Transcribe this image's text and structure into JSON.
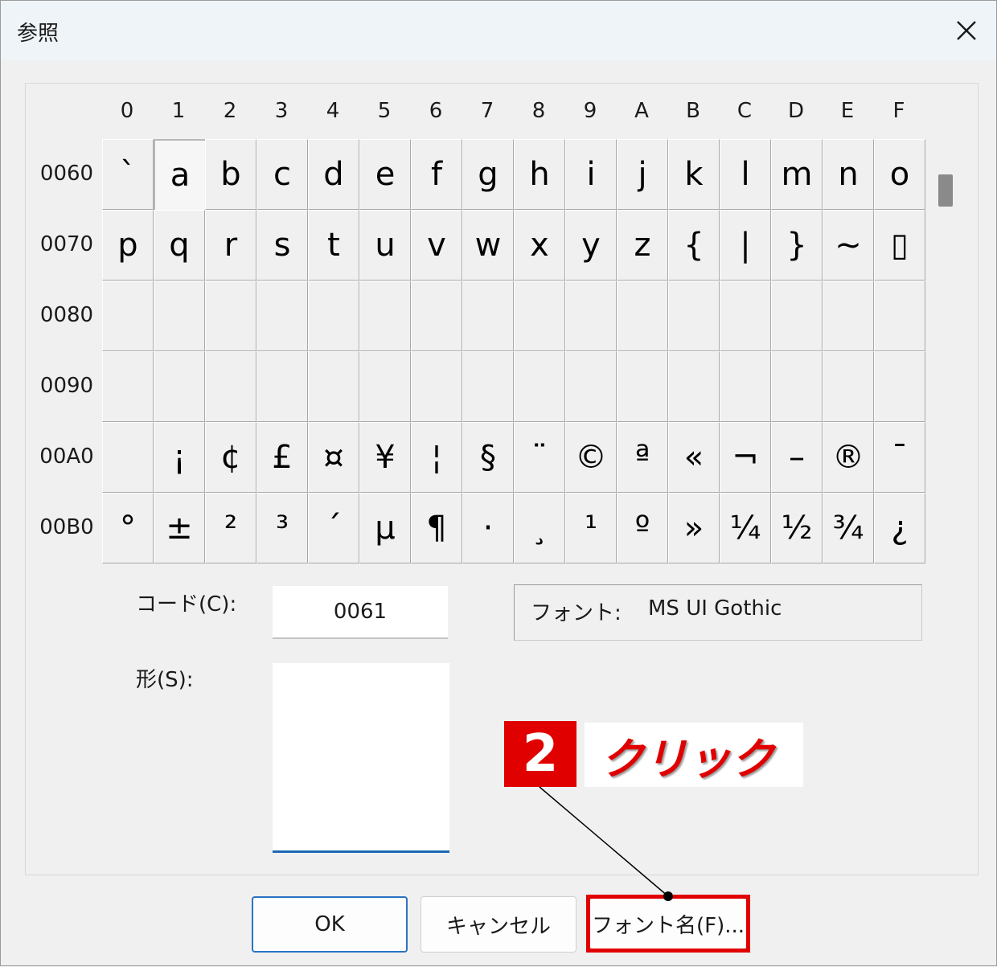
{
  "title": "参照",
  "column_headers": [
    "0",
    "1",
    "2",
    "3",
    "4",
    "5",
    "6",
    "7",
    "8",
    "9",
    "A",
    "B",
    "C",
    "D",
    "E",
    "F"
  ],
  "rows": [
    {
      "label": "0060",
      "chars": [
        "`",
        "a",
        "b",
        "c",
        "d",
        "e",
        "f",
        "g",
        "h",
        "i",
        "j",
        "k",
        "l",
        "m",
        "n",
        "o"
      ]
    },
    {
      "label": "0070",
      "chars": [
        "p",
        "q",
        "r",
        "s",
        "t",
        "u",
        "v",
        "w",
        "x",
        "y",
        "z",
        "{",
        "|",
        "}",
        "~",
        "▯"
      ]
    },
    {
      "label": "0080",
      "chars": [
        "",
        "",
        "",
        "",
        "",
        "",
        "",
        "",
        "",
        "",
        "",
        "",
        "",
        "",
        "",
        ""
      ]
    },
    {
      "label": "0090",
      "chars": [
        "",
        "",
        "",
        "",
        "",
        "",
        "",
        "",
        "",
        "",
        "",
        "",
        "",
        "",
        "",
        ""
      ]
    },
    {
      "label": "00A0",
      "chars": [
        "",
        "¡",
        "¢",
        "£",
        "¤",
        "¥",
        "¦",
        "§",
        "¨",
        "©",
        "ª",
        "«",
        "¬",
        "–",
        "®",
        "¯"
      ]
    },
    {
      "label": "00B0",
      "chars": [
        "°",
        "±",
        "²",
        "³",
        "´",
        "µ",
        "¶",
        "·",
        "¸",
        "¹",
        "º",
        "»",
        "¼",
        "½",
        "¾",
        "¿"
      ]
    }
  ],
  "selected": {
    "row": 0,
    "col": 1
  },
  "code_label": "コード(C):",
  "code_value": "0061",
  "font_label": "フォント:",
  "font_value": "MS UI Gothic",
  "shape_label": "形(S):",
  "buttons": {
    "ok": "OK",
    "cancel": "キャンセル",
    "font_name": "フォント名(F)..."
  },
  "callout": {
    "number": "2",
    "text": "クリック"
  },
  "colors": {
    "highlight": "#e00000",
    "focus": "#1b68b5"
  },
  "icons": {
    "close": "close-icon"
  }
}
